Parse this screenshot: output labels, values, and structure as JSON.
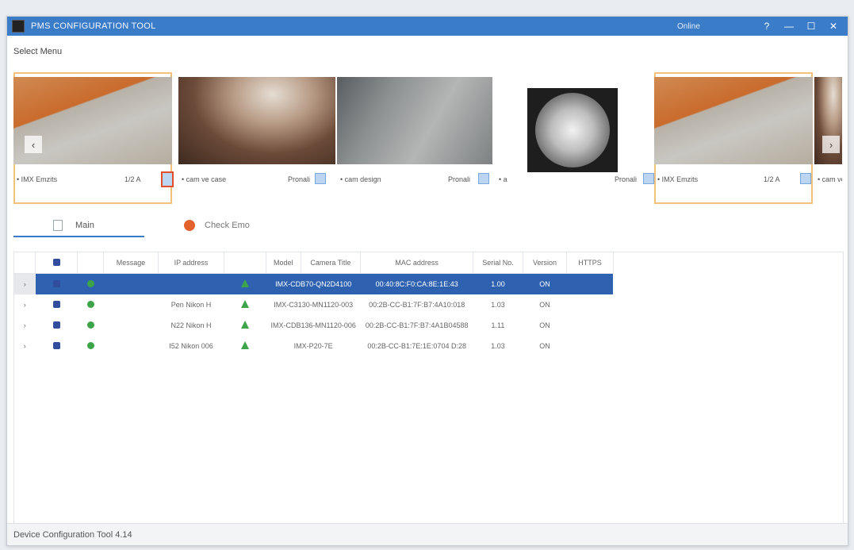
{
  "window": {
    "title": "PMS CONFIGURATION TOOL",
    "status": "Online",
    "controls": [
      "?",
      "—",
      "☐",
      "✕"
    ]
  },
  "select_menu_label": "Select Menu",
  "thumbnails": [
    {
      "caption": "• IMX Emzits",
      "caption_right": "1/2 A",
      "selected": true,
      "image": "orange-room"
    },
    {
      "caption": "• cam ve case",
      "caption_right": "Pronali",
      "image": "brown-blur"
    },
    {
      "caption": "• cam design",
      "caption_right": "Pronali",
      "image": "gray-wall"
    },
    {
      "caption": "• a",
      "caption_right": "Pronali",
      "image": "fisheye"
    },
    {
      "caption": "• IMX Emzits",
      "caption_right": "1/2 A",
      "selected": true,
      "image": "orange-room"
    },
    {
      "caption": "• cam ve",
      "image": "brown-blur"
    }
  ],
  "tabs": {
    "main": "Main",
    "alt": "Check Emo"
  },
  "table": {
    "columns": [
      "",
      "",
      "Message",
      "IP address",
      "",
      "Model",
      "Camera Title",
      "MAC address",
      "Serial No.",
      "Version",
      "HTTPS"
    ],
    "rows": [
      {
        "selected": true,
        "message": "",
        "ip": "",
        "model": "IMX-CDB70-QN2D4100",
        "mac": "00:40:8C:F0:CA:8E:1E:43",
        "serial": "1.00",
        "version": "ON",
        "https": ""
      },
      {
        "message": "",
        "ip": "Pen Nikon H",
        "model": "IMX-C3130-MN1120-003",
        "mac": "00:2B-CC-B1:7F:B7:4A10:018",
        "serial": "1.03",
        "version": "ON",
        "https": ""
      },
      {
        "message": "",
        "ip": "N22 Nikon H",
        "model": "IMX-CDB136-MN1120-006",
        "mac": "00:2B-CC-B1:7F:B7:4A1B04588",
        "serial": "1.11",
        "version": "ON",
        "https": ""
      },
      {
        "message": "",
        "ip": "I52 Nikon 006",
        "model": "IMX-P20-7E",
        "mac": "00:2B-CC-B1:7E:1E:0704 D:28",
        "serial": "1.03",
        "version": "ON",
        "https": ""
      }
    ]
  },
  "statusbar": {
    "text": "Device Configuration Tool  4.14"
  },
  "colors": {
    "accent": "#3b7cc9",
    "selected_row": "#2e62b0",
    "thumb_highlight": "#f1c27d",
    "active_check": "#e0502a",
    "status_green": "#3ea44a"
  }
}
